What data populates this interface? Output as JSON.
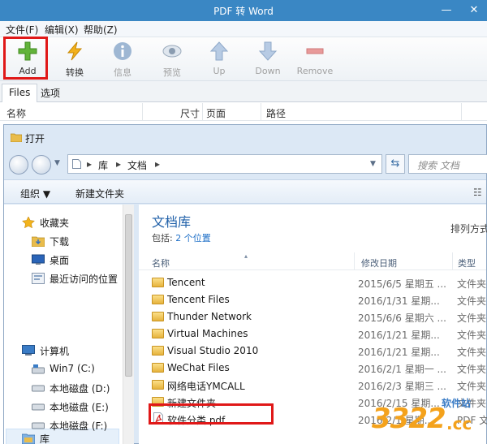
{
  "app": {
    "title": "PDF 转 Word",
    "menu": [
      "文件(F)",
      "编辑(X)",
      "帮助(Z)"
    ],
    "window_controls": {
      "minimize": "—",
      "close": "✕"
    }
  },
  "toolbar": {
    "add": "Add",
    "convert": "转换",
    "info": "信息",
    "preview": "预览",
    "up": "Up",
    "down": "Down",
    "remove": "Remove"
  },
  "tabs": [
    "Files",
    "选项"
  ],
  "file_columns": [
    "名称",
    "尺寸",
    "页面",
    "路径"
  ],
  "dialog": {
    "title": "打开",
    "breadcrumb": [
      "库",
      "文档"
    ],
    "search_placeholder": "搜索 文档",
    "commands": {
      "organize": "组织 ▼",
      "new_folder": "新建文件夹"
    },
    "library": {
      "title": "文档库",
      "includes_label": "包括: ",
      "includes_link": "2 个位置",
      "arrange": "排列方式"
    },
    "list_columns": {
      "name": "名称",
      "modified": "修改日期",
      "type": "类型"
    },
    "nav": {
      "favorites": "收藏夹",
      "downloads": "下载",
      "desktop": "桌面",
      "recent": "最近访问的位置",
      "libraries": "库",
      "computer": "计算机",
      "drive_c": "Win7 (C:)",
      "drive_d": "本地磁盘 (D:)",
      "drive_e": "本地磁盘 (E:)",
      "drive_f": "本地磁盘 (F:)"
    },
    "files": [
      {
        "name": "Tencent",
        "date": "2015/6/5 星期五 ...",
        "type": "文件夹",
        "kind": "folder"
      },
      {
        "name": "Tencent Files",
        "date": "2016/1/31 星期...",
        "type": "文件夹",
        "kind": "folder"
      },
      {
        "name": "Thunder Network",
        "date": "2015/6/6 星期六 ...",
        "type": "文件夹",
        "kind": "folder"
      },
      {
        "name": "Virtual Machines",
        "date": "2016/1/21 星期...",
        "type": "文件夹",
        "kind": "folder"
      },
      {
        "name": "Visual Studio 2010",
        "date": "2016/1/21 星期...",
        "type": "文件夹",
        "kind": "folder"
      },
      {
        "name": "WeChat Files",
        "date": "2016/2/1 星期一 ...",
        "type": "文件夹",
        "kind": "folder"
      },
      {
        "name": "网络电话YMCALL",
        "date": "2016/2/3 星期三 ...",
        "type": "文件夹",
        "kind": "folder"
      },
      {
        "name": "新建文件夹",
        "date": "2016/2/15 星期...",
        "type": "文件夹",
        "kind": "folder"
      },
      {
        "name": "软件分类.pdf",
        "date": "2016/2/1 星期...",
        "type": "PDF 文...",
        "kind": "pdf"
      }
    ]
  },
  "watermark": {
    "number": "3322",
    "domain": ".cc",
    "site": "软件站"
  },
  "colors": {
    "accent": "#3a87c4",
    "highlight": "#e01818",
    "link": "#1e6fc7"
  }
}
